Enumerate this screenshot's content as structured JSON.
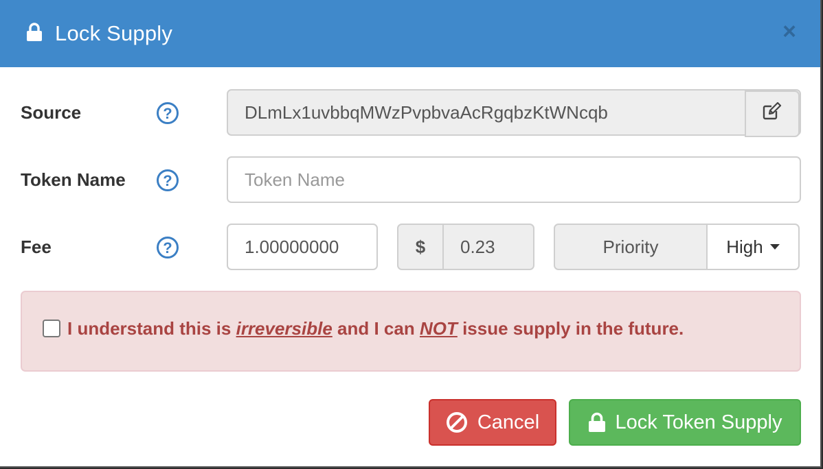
{
  "header": {
    "title": "Lock Supply",
    "close_label": "×",
    "icons": {
      "title": "lock-icon",
      "close": "close-icon"
    }
  },
  "form": {
    "source": {
      "label": "Source",
      "value": "DLmLx1uvbbqMWzPvpbvaAcRgqbzKtWNcqb",
      "help": "?",
      "edit_icon": "edit-icon"
    },
    "token_name": {
      "label": "Token Name",
      "placeholder": "Token Name",
      "value": "",
      "help": "?"
    },
    "fee": {
      "label": "Fee",
      "help": "?",
      "value": "1.00000000",
      "currency_symbol": "$",
      "usd_value": "0.23",
      "priority_label": "Priority",
      "priority_value": "High"
    }
  },
  "warning": {
    "checked": false,
    "text_1": "I understand this is ",
    "emph_1": "irreversible",
    "text_2": " and I can ",
    "emph_2": "NOT",
    "text_3": " issue supply in the future."
  },
  "buttons": {
    "cancel": "Cancel",
    "lock": "Lock Token Supply"
  },
  "colors": {
    "header": "#4089cb",
    "danger": "#d9534f",
    "success": "#5cb85c",
    "alert_bg": "#f2dede",
    "alert_text": "#a94442",
    "help": "#3b7fc4"
  }
}
